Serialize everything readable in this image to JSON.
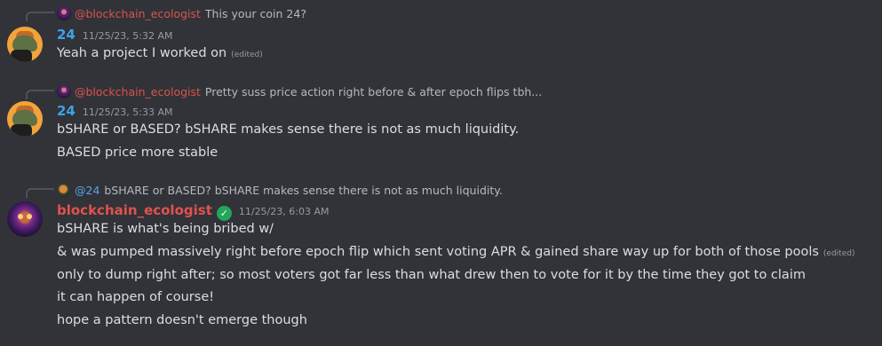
{
  "messages": [
    {
      "reply": {
        "author": "@blockchain_ecologist",
        "text": "This your coin 24?"
      },
      "author": "24",
      "timestamp": "11/25/23, 5:32 AM",
      "lines": [
        {
          "text": "Yeah a project I worked on",
          "edited": "(edited)"
        }
      ]
    },
    {
      "reply": {
        "author": "@blockchain_ecologist",
        "text": "Pretty suss price action right before & after epoch flips tbh..."
      },
      "author": "24",
      "timestamp": "11/25/23, 5:33 AM",
      "lines": [
        {
          "text": "bSHARE or BASED? bSHARE makes sense there is not as much liquidity."
        },
        {
          "text": "BASED price more stable"
        }
      ]
    },
    {
      "reply": {
        "author": "@24",
        "text": "bSHARE or BASED? bSHARE makes sense there is not as much liquidity."
      },
      "author": "blockchain_ecologist",
      "timestamp": "11/25/23, 6:03 AM",
      "lines": [
        {
          "text": "bSHARE is what's being bribed w/"
        },
        {
          "text": "& was pumped massively right before epoch flip which sent voting APR & gained share way up for both of those pools",
          "edited": "(edited)"
        },
        {
          "text": "only to dump right after; so most voters got far less than what drew then to vote for it by the time they got to claim"
        },
        {
          "text": "it can happen of course!"
        },
        {
          "text": "hope a pattern doesn't emerge though"
        }
      ]
    }
  ],
  "icons": {
    "verified": "checkmark-badge-icon",
    "verified_glyph": "✓"
  },
  "colors": {
    "background": "#313338",
    "author_24": "#3ea2e8",
    "author_blockchain_ecologist": "#e0524e",
    "verified": "#23a55a"
  }
}
